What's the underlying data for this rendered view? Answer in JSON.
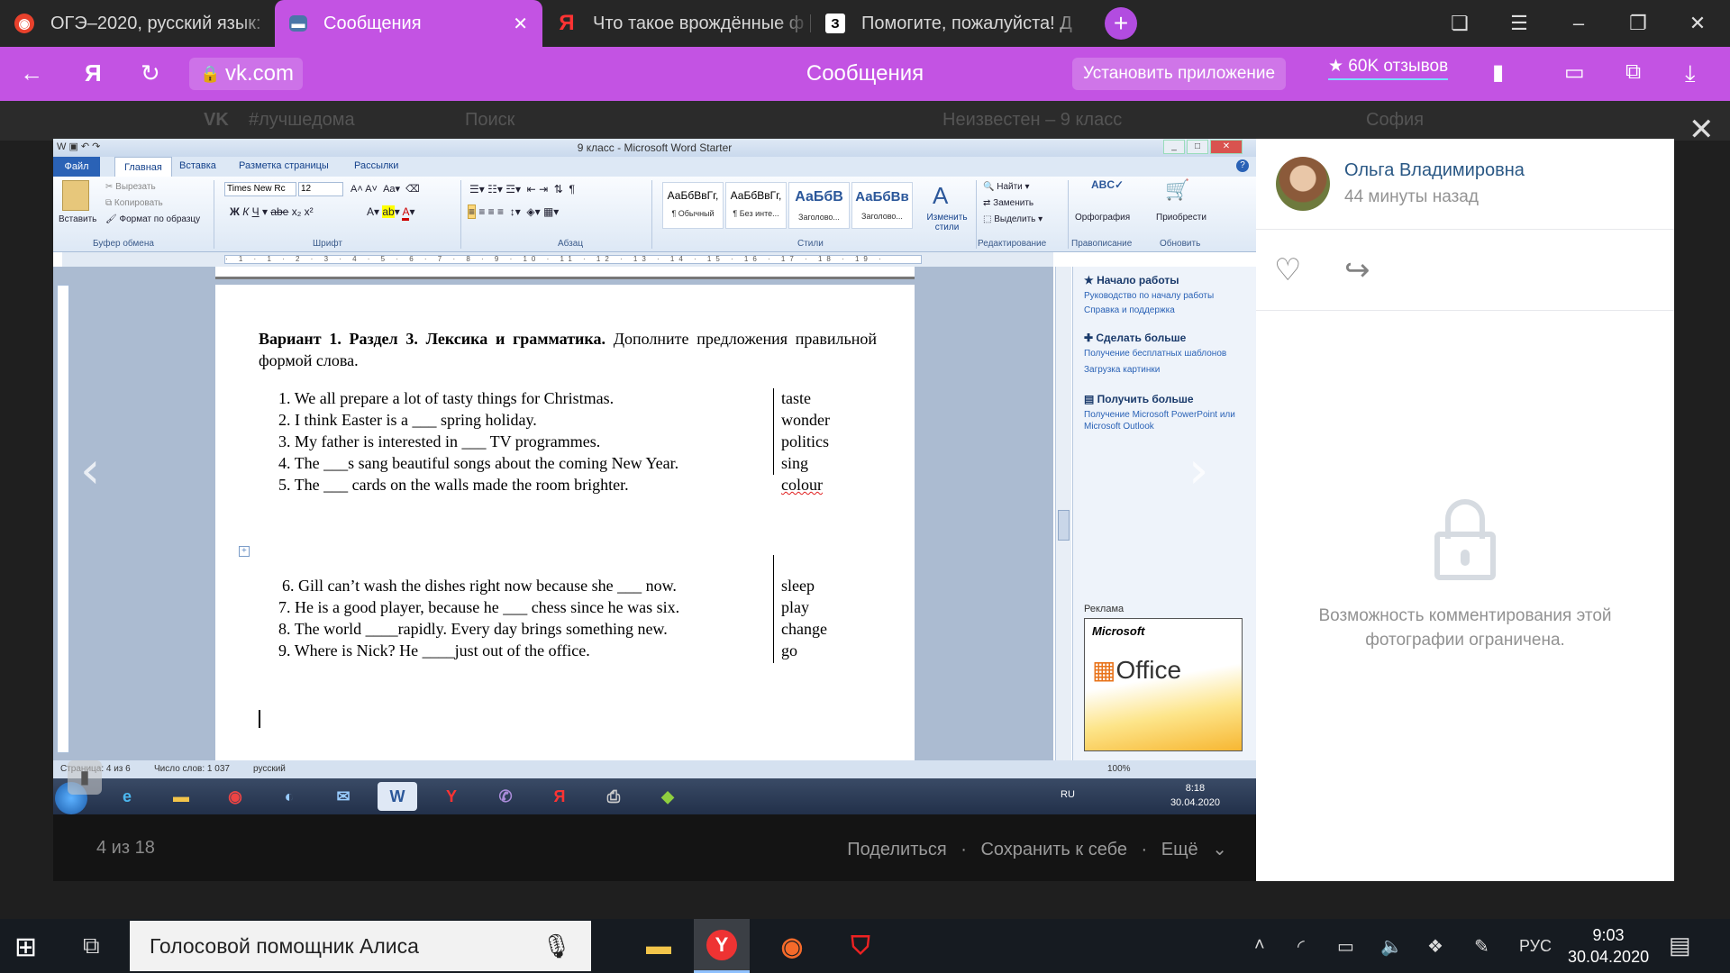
{
  "browser": {
    "tabs": [
      {
        "label": "ОГЭ–2020, русский язык:"
      },
      {
        "label": "Сообщения",
        "active": true
      },
      {
        "label": "Что такое врождённые ф"
      },
      {
        "label": "Помогите, пожалуйста! Д"
      }
    ],
    "url": "vk.com",
    "page_title": "Сообщения",
    "install_label": "Установить приложение",
    "reviews_label": "★ 60K отзывов"
  },
  "vk": {
    "hashtag": "#лучшедома",
    "search_placeholder": "Поиск",
    "player_text": "Неизвестен – 9 класс",
    "user": "София"
  },
  "viewer": {
    "counter": "4 из 18",
    "share": "Поделиться",
    "save": "Сохранить к себе",
    "more": "Ещё",
    "sep": "·"
  },
  "word": {
    "title": "9 класс - Microsoft Word Starter",
    "file_tab": "Файл",
    "tabs": [
      "Главная",
      "Вставка",
      "Разметка страницы",
      "Рассылки"
    ],
    "clipboard": {
      "paste": "Вставить",
      "cut": "Вырезать",
      "copy": "Копировать",
      "format": "Формат по образцу",
      "label": "Буфер обмена"
    },
    "font": {
      "name": "Times New Rc",
      "size": "12",
      "label": "Шрифт"
    },
    "paragraph_label": "Абзац",
    "styles": [
      {
        "sample": "АаБбВвГг,",
        "name": "¶ Обычный"
      },
      {
        "sample": "АаБбВвГг,",
        "name": "¶ Без инте..."
      },
      {
        "sample": "АаБбВ",
        "name": "Заголово..."
      },
      {
        "sample": "АаБбВв",
        "name": "Заголово..."
      }
    ],
    "styles_label": "Стили",
    "change_styles": "Изменить стили",
    "editing": {
      "find": "Найти",
      "replace": "Заменить",
      "select": "Выделить",
      "label": "Редактирование"
    },
    "spelling": "Орфография",
    "spelling_label": "Правописание",
    "buy": "Приобрести",
    "update_label": "Обновить",
    "doc": {
      "task_bold": "Вариант 1. Раздел 3. Лексика и грамматика.",
      "task_rest": " Дополните предложения правильной формой слова.",
      "block1": [
        {
          "num": "1.",
          "text": "We all prepare a lot of tasty things for Christmas.",
          "word": "taste"
        },
        {
          "num": "2.",
          "text": "I think Easter is a ___ spring holiday.",
          "word": "wonder"
        },
        {
          "num": "3.",
          "text": "My father is interested in ___ TV programmes.",
          "word": "politics"
        },
        {
          "num": "4.",
          "text": "The ___s sang beautiful songs about the coming New Year.",
          "word": "sing"
        },
        {
          "num": "5.",
          "text": "The ___ cards on the walls made the room brighter.",
          "word": "colour"
        }
      ],
      "block2": [
        {
          "num": "6.",
          "text": "Gill can’t wash the dishes right now because she ___ now.",
          "word": "sleep"
        },
        {
          "num": "7.",
          "text": "He is a good player, because he ___ chess since he was six.",
          "word": "play"
        },
        {
          "num": "8.",
          "text": "The world ____rapidly. Every day brings something new.",
          "word": "change"
        },
        {
          "num": "9.",
          "text": "Where is Nick? He ____just out of the office.",
          "word": "go"
        }
      ]
    },
    "taskpane": {
      "h1": "Начало работы",
      "l1": "Руководство по началу работы",
      "l2": "Справка и поддержка",
      "h2": "Сделать больше",
      "l3": "Получение бесплатных шаблонов",
      "l4": "Загрузка картинки",
      "h3": "Получить больше",
      "l5": "Получение Microsoft PowerPoint или Microsoft Outlook",
      "ad_label": "Реклама",
      "ad_brand": "Microsoft",
      "ad_product": "Office"
    },
    "status": {
      "page": "Страница: 4 из 6",
      "words": "Число слов: 1 037",
      "lang": "русский",
      "zoom": "100%"
    },
    "clock": {
      "time": "8:18",
      "date": "30.04.2020",
      "lang": "RU"
    }
  },
  "comments": {
    "author": "Ольга Владимировна",
    "time": "44 минуты назад",
    "restricted": "Возможность комментирования этой фотографии ограничена."
  },
  "taskbar": {
    "search": "Голосовой помощник Алиса",
    "lang": "РУС",
    "time": "9:03",
    "date": "30.04.2020"
  }
}
